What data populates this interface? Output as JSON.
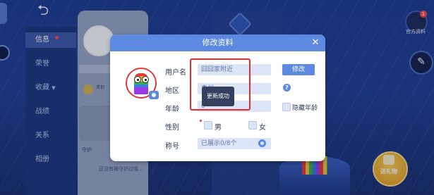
{
  "background": {
    "sidebar": {
      "items": [
        {
          "label": "信息"
        },
        {
          "label": "荣誉"
        },
        {
          "label": "收藏"
        },
        {
          "label": "战绩"
        },
        {
          "label": "关系"
        },
        {
          "label": "相册"
        }
      ]
    },
    "card": {
      "rank_text": "青铜"
    },
    "guard_label": "守护",
    "bottom_text": "还没有被守护过哦...",
    "top_right_label": "官方资料",
    "top_right_badge": "1",
    "gift_label": "送礼物"
  },
  "modal": {
    "title": "修改资料",
    "close_icon": "close-icon",
    "fields": {
      "username_label": "用户名",
      "username_value": "囧囧家附近",
      "edit_button": "修改",
      "region_label": "地区",
      "region_value": "贵州",
      "age_label": "年龄",
      "age_value": "0",
      "hide_age_label": "隐藏年龄",
      "gender_label": "性别",
      "male_label": "男",
      "female_label": "女",
      "title_label": "称号",
      "title_value": "已展示0/8个"
    },
    "toast": "更新成功"
  },
  "colors": {
    "accent": "#5d8ae0",
    "highlight": "#e42d2d"
  }
}
